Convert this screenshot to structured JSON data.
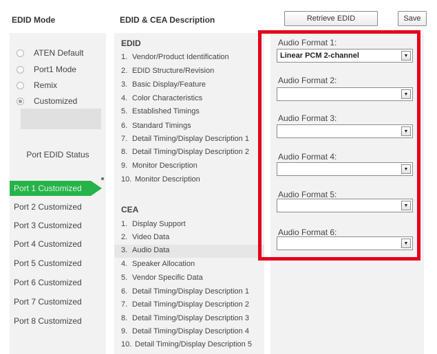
{
  "header": {
    "edid_mode_title": "EDID Mode",
    "edid_cea_title": "EDID & CEA Description",
    "retrieve_label": "Retrieve EDID",
    "save_label": "Save"
  },
  "modes": [
    {
      "label": "ATEN Default",
      "checked": false
    },
    {
      "label": "Port1 Mode",
      "checked": false
    },
    {
      "label": "Remix",
      "checked": false
    },
    {
      "label": "Customized",
      "checked": true
    }
  ],
  "port_status_title": "Port EDID Status",
  "ports": [
    "Port 1 Customized",
    "Port 2 Customized",
    "Port 3 Customized",
    "Port 4 Customized",
    "Port 5 Customized",
    "Port 6 Customized",
    "Port 7 Customized",
    "Port 8 Customized"
  ],
  "edid": {
    "title": "EDID",
    "items": [
      {
        "num": "1.",
        "label": "Vendor/Product Identification"
      },
      {
        "num": "2.",
        "label": "EDID Structure/Revision"
      },
      {
        "num": "3.",
        "label": "Basic Display/Feature"
      },
      {
        "num": "4.",
        "label": "Color Characteristics"
      },
      {
        "num": "5.",
        "label": "Established Timings"
      },
      {
        "num": "6.",
        "label": "Standard Timings"
      },
      {
        "num": "7.",
        "label": "Detail Timing/Display Description 1"
      },
      {
        "num": "8.",
        "label": "Detail Timing/Display Description 2"
      },
      {
        "num": "9.",
        "label": "Monitor Description"
      },
      {
        "num": "10.",
        "label": "Monitor Description"
      }
    ]
  },
  "cea": {
    "title": "CEA",
    "items": [
      {
        "num": "1.",
        "label": "Display Support"
      },
      {
        "num": "2.",
        "label": "Video Data"
      },
      {
        "num": "3.",
        "label": "Audio Data"
      },
      {
        "num": "4.",
        "label": "Speaker Allocation"
      },
      {
        "num": "5.",
        "label": "Vendor Specific Data"
      },
      {
        "num": "6.",
        "label": "Detail Timing/Display Description 1"
      },
      {
        "num": "7.",
        "label": "Detail Timing/Display Description 2"
      },
      {
        "num": "8.",
        "label": "Detail Timing/Display Description 3"
      },
      {
        "num": "9.",
        "label": "Detail Timing/Display Description 4"
      },
      {
        "num": "10.",
        "label": "Detail Timing/Display Description 5"
      }
    ]
  },
  "audio_formats": [
    {
      "label": "Audio Format 1:",
      "value": "Linear PCM 2-channel"
    },
    {
      "label": "Audio Format 2:",
      "value": ""
    },
    {
      "label": "Audio Format 3:",
      "value": ""
    },
    {
      "label": "Audio Format 4:",
      "value": ""
    },
    {
      "label": "Audio Format 5:",
      "value": ""
    },
    {
      "label": "Audio Format 6:",
      "value": ""
    }
  ],
  "colors": {
    "active_port": "#27b34a",
    "highlight": "#e4001b"
  }
}
